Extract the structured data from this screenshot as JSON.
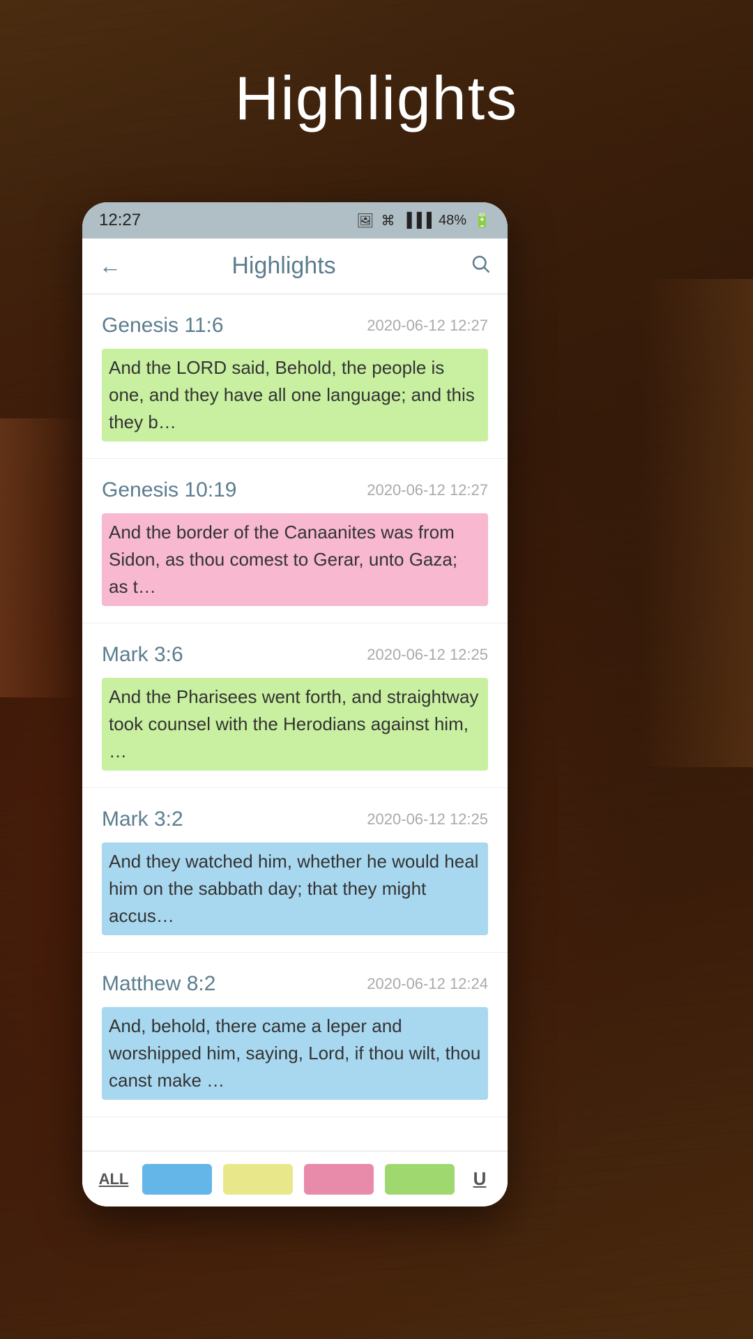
{
  "page": {
    "title": "Highlights",
    "background_color": "#3d2010"
  },
  "status_bar": {
    "time": "12:27",
    "battery": "48%",
    "signal_icon": "signal-icon",
    "battery_icon": "battery-icon",
    "photo_icon": "photo-icon",
    "bluetooth_icon": "bluetooth-icon"
  },
  "header": {
    "title": "Highlights",
    "back_label": "←",
    "search_label": "🔍"
  },
  "highlights": [
    {
      "reference": "Genesis 11:6",
      "date": "2020-06-12 12:27",
      "text": "And the LORD said, Behold, the people is one, and they have all one language; and this they b…",
      "highlight_color": "green"
    },
    {
      "reference": "Genesis 10:19",
      "date": "2020-06-12 12:27",
      "text": "And the border of the Canaanites was from Sidon, as thou comest to Gerar, unto Gaza; as t…",
      "highlight_color": "pink"
    },
    {
      "reference": "Mark 3:6",
      "date": "2020-06-12 12:25",
      "text": "And the Pharisees went forth, and straightway took counsel with the Herodians against him, …",
      "highlight_color": "green"
    },
    {
      "reference": "Mark 3:2",
      "date": "2020-06-12 12:25",
      "text": "And they watched him, whether he would heal him on the sabbath day; that they might accus…",
      "highlight_color": "blue"
    },
    {
      "reference": "Matthew 8:2",
      "date": "2020-06-12 12:24",
      "text": "And, behold, there came a leper and worshipped him, saying, Lord, if thou wilt, thou canst make …",
      "highlight_color": "blue"
    }
  ],
  "bottom_bar": {
    "all_label": "ALL",
    "underline_label": "U",
    "swatches": [
      "blue",
      "yellow",
      "pink",
      "green"
    ]
  }
}
